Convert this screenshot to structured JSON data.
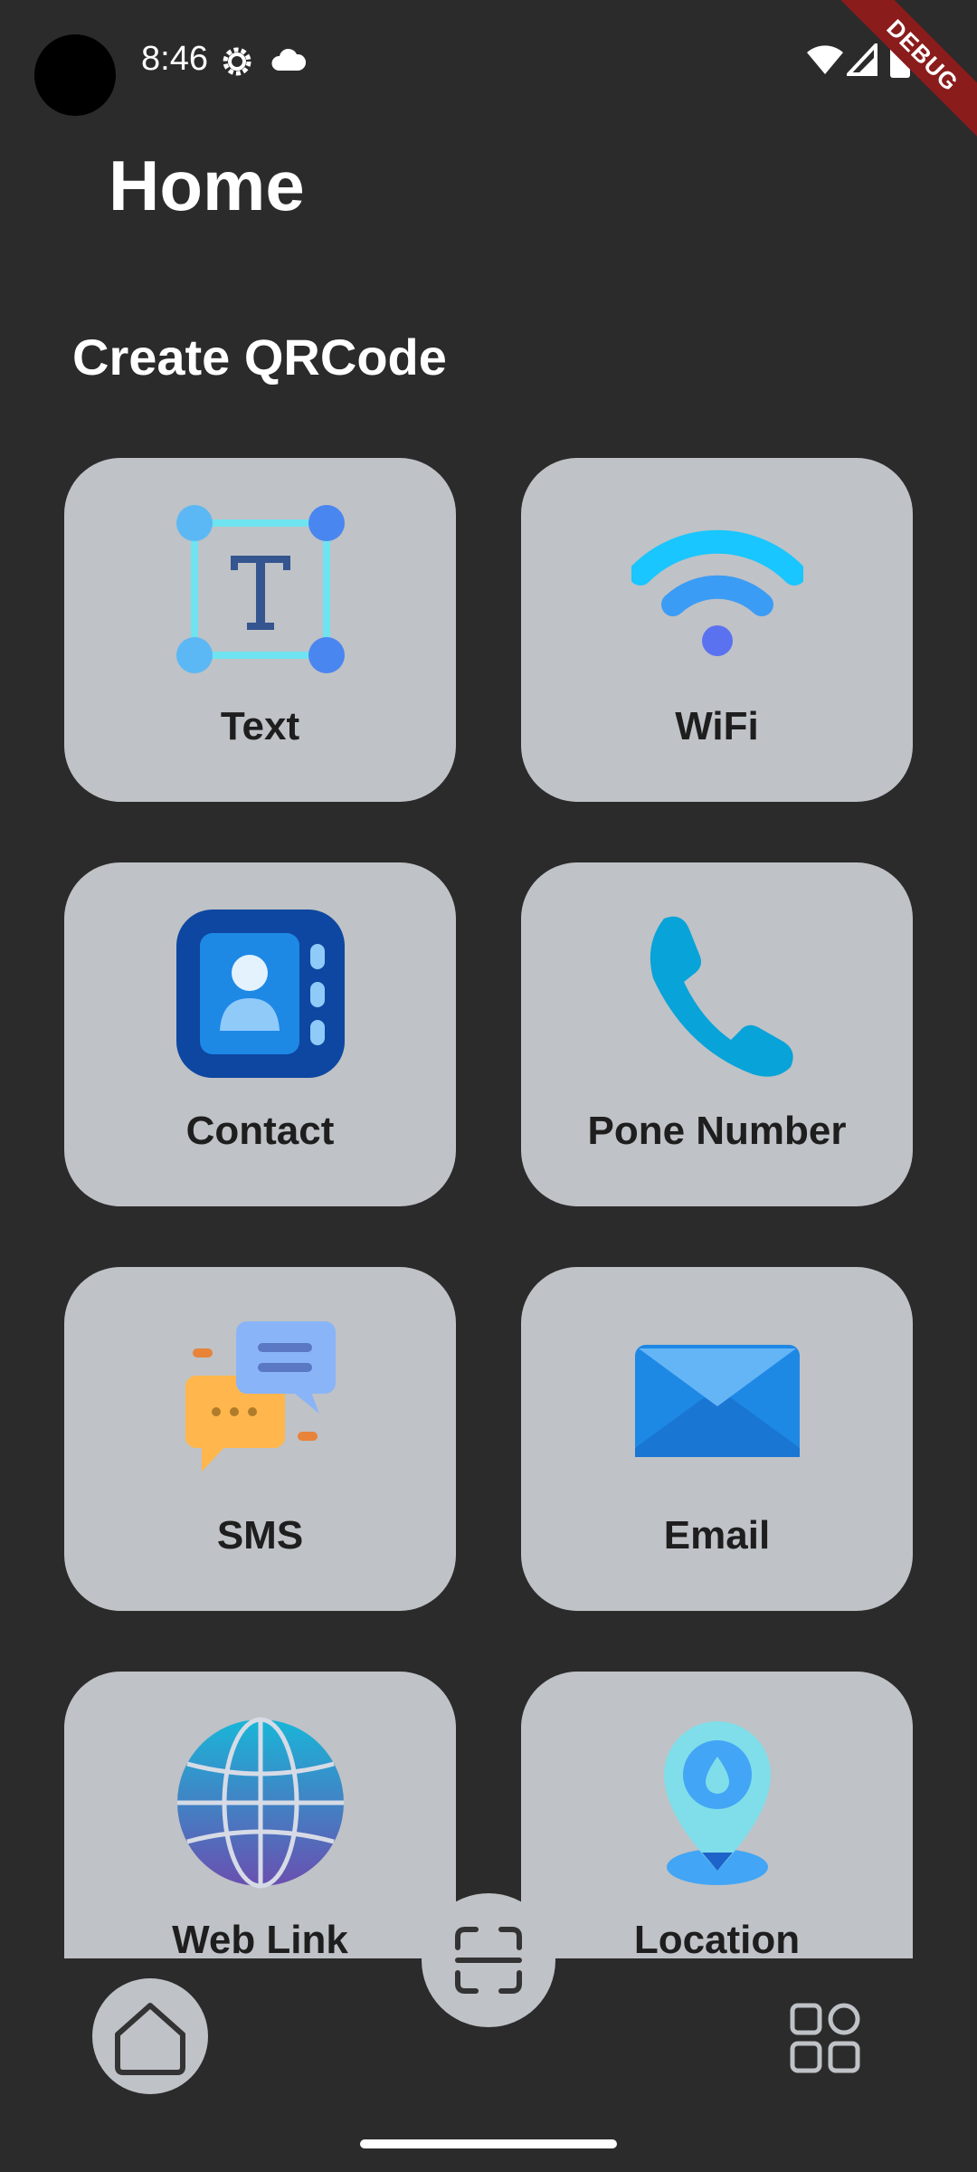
{
  "status_bar": {
    "time": "8:46"
  },
  "debug_banner": "DEBUG",
  "header": {
    "title": "Home"
  },
  "section": {
    "title": "Create QRCode"
  },
  "cards": [
    {
      "label": "Text",
      "icon": "text-box-icon"
    },
    {
      "label": "WiFi",
      "icon": "wifi-icon"
    },
    {
      "label": "Contact",
      "icon": "contact-book-icon"
    },
    {
      "label": "Pone Number",
      "icon": "phone-icon"
    },
    {
      "label": "SMS",
      "icon": "chat-bubbles-icon"
    },
    {
      "label": "Email",
      "icon": "envelope-icon"
    },
    {
      "label": "Web Link",
      "icon": "globe-icon"
    },
    {
      "label": "Location",
      "icon": "location-pin-icon"
    }
  ],
  "bottom_nav": {
    "home_icon": "home-icon",
    "scan_icon": "scan-icon",
    "menu_icon": "grid-menu-icon"
  },
  "colors": {
    "background": "#2b2b2b",
    "card": "#bfc2c6",
    "card_text": "#1e1e1e"
  }
}
